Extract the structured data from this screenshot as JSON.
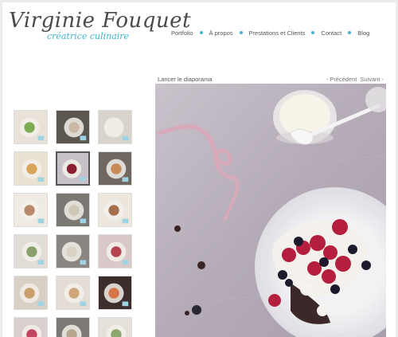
{
  "brand": {
    "name": "Virginie Fouquet",
    "tagline": "créatrice culinaire"
  },
  "nav": {
    "items": [
      "Portfolio",
      "À propos",
      "Prestations et Clients",
      "Contact",
      "Blog"
    ]
  },
  "gallery": {
    "slideshow_label": "Lancer le diaporama",
    "prev_label": "- Précédent",
    "next_label": "Suivant -",
    "selected_index": 4
  },
  "thumbs": [
    {
      "bg": "#e8e2d8",
      "fg": "#7faa54"
    },
    {
      "bg": "#5c5650",
      "fg": "#c9b9a6"
    },
    {
      "bg": "#d8d4cc",
      "fg": "#f1ede3"
    },
    {
      "bg": "#e9e2d2",
      "fg": "#d9a55a"
    },
    {
      "bg": "#c8c0c8",
      "fg": "#8a1e33"
    },
    {
      "bg": "#6f6760",
      "fg": "#c98b55"
    },
    {
      "bg": "#efeae2",
      "fg": "#b78a6b"
    },
    {
      "bg": "#7b7772",
      "fg": "#cfc6b7"
    },
    {
      "bg": "#ece6dc",
      "fg": "#a5714d"
    },
    {
      "bg": "#e2dcd6",
      "fg": "#8aa06a"
    },
    {
      "bg": "#8a8580",
      "fg": "#d9d2c4"
    },
    {
      "bg": "#d9c8c8",
      "fg": "#b5434f"
    },
    {
      "bg": "#d8d0c4",
      "fg": "#c9a06b"
    },
    {
      "bg": "#e3ddd6",
      "fg": "#cfa77a"
    },
    {
      "bg": "#3c2e2c",
      "fg": "#d7744a"
    },
    {
      "bg": "#d9cfcf",
      "fg": "#c2435f"
    },
    {
      "bg": "#7d7873",
      "fg": "#b9a68e"
    },
    {
      "bg": "#e5e0d8",
      "fg": "#8ea76d"
    }
  ],
  "colors": {
    "accent": "#42b3d0"
  }
}
